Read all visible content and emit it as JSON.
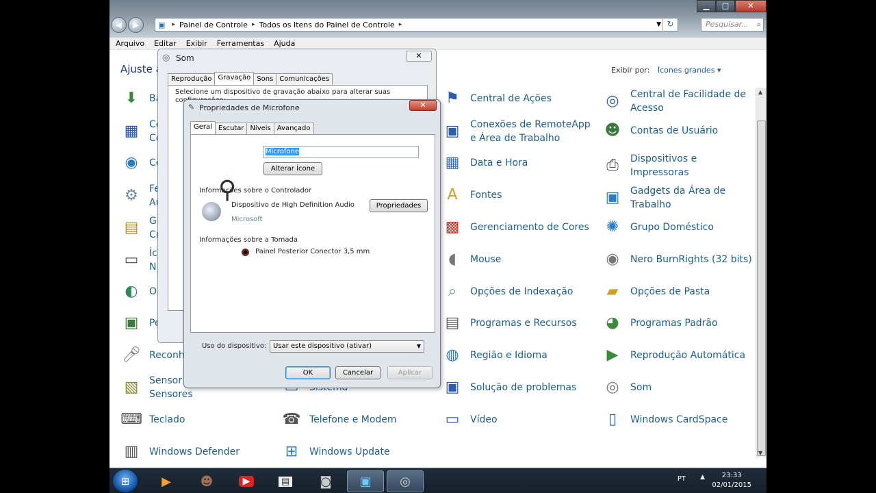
{
  "window": {
    "address": [
      "Painel de Controle",
      "Todos os Itens do Painel de Controle"
    ],
    "search_placeholder": "Pesquisar...",
    "caption": {
      "minimize": "▁",
      "maximize": "□",
      "close": "✕"
    }
  },
  "menubar": [
    "Arquivo",
    "Editar",
    "Exibir",
    "Ferramentas",
    "Ajuda"
  ],
  "header": {
    "title": "Ajuste as",
    "viewby_label": "Exibir por:",
    "viewby_value": "Ícones grandes ▾"
  },
  "items": [
    {
      "label": "Ba",
      "icon": "backup-icon"
    },
    {
      "label": "Ce Co",
      "icon": "certificate-icon"
    },
    {
      "label": "Ce",
      "icon": "center-icon"
    },
    {
      "label": "Fe Au",
      "icon": "tools-icon"
    },
    {
      "label": "Ge Cr",
      "icon": "credential-icon"
    },
    {
      "label": "Íc N",
      "icon": "notification-icon"
    },
    {
      "label": "Op",
      "icon": "options-icon"
    },
    {
      "label": "Pe",
      "icon": "personalize-icon"
    },
    {
      "label": "Reconhe",
      "icon": "microphone-icon"
    },
    {
      "label": "Sensor Outros Sensores",
      "icon": "sensor-icon"
    },
    {
      "label": "Teclado",
      "icon": "keyboard-icon"
    },
    {
      "label": "Windows Defender",
      "icon": "defender-icon"
    },
    {
      "label": "Sistema",
      "icon": "system-icon"
    },
    {
      "label": "Telefone e Modem",
      "icon": "phone-icon"
    },
    {
      "label": "Windows Update",
      "icon": "update-icon"
    },
    {
      "label": "Central de Ações",
      "icon": "flag-icon"
    },
    {
      "label": "Conexões de RemoteApp e Área de Trabalho",
      "icon": "remoteapp-icon"
    },
    {
      "label": "Data e Hora",
      "icon": "calendar-icon"
    },
    {
      "label": "Fontes",
      "icon": "font-icon"
    },
    {
      "label": "Gerenciamento de Cores",
      "icon": "color-icon"
    },
    {
      "label": "Mouse",
      "icon": "mouse-icon"
    },
    {
      "label": "Opções de Indexação",
      "icon": "index-icon"
    },
    {
      "label": "Programas e Recursos",
      "icon": "programs-icon"
    },
    {
      "label": "Região e Idioma",
      "icon": "globe-icon"
    },
    {
      "label": "Solução de problemas",
      "icon": "troubleshoot-icon"
    },
    {
      "label": "Vídeo",
      "icon": "monitor-icon"
    },
    {
      "label": "Central de Facilidade de Acesso",
      "icon": "accessibility-icon"
    },
    {
      "label": "Contas de Usuário",
      "icon": "users-icon"
    },
    {
      "label": "Dispositivos e Impressoras",
      "icon": "printer-icon"
    },
    {
      "label": "Gadgets da Área de Trabalho",
      "icon": "gadgets-icon"
    },
    {
      "label": "Grupo Doméstico",
      "icon": "homegroup-icon"
    },
    {
      "label": "Nero BurnRights (32 bits)",
      "icon": "nero-icon"
    },
    {
      "label": "Opções de Pasta",
      "icon": "folder-icon"
    },
    {
      "label": "Programas Padrão",
      "icon": "default-programs-icon"
    },
    {
      "label": "Reprodução Automática",
      "icon": "autoplay-icon"
    },
    {
      "label": "Som",
      "icon": "speaker-icon"
    },
    {
      "label": "Windows CardSpace",
      "icon": "cardspace-icon"
    }
  ],
  "som": {
    "title": "Som",
    "close": "✕",
    "tabs": [
      "Reprodução",
      "Gravação",
      "Sons",
      "Comunicações"
    ],
    "desc": "Selecione um dispositivo de gravação abaixo para alterar suas configurações:"
  },
  "mic": {
    "title": "Propriedades de Microfone",
    "close": "✕",
    "tabs": [
      "Geral",
      "Escutar",
      "Níveis",
      "Avançado"
    ],
    "name_value": "Microfone",
    "change_icon": "Alterar Ícone",
    "controller_heading": "Informações sobre o Controlador",
    "controller_name": "Dispositivo de High Definition Audio",
    "controller_vendor": "Microsoft",
    "properties_btn": "Propriedades",
    "jack_heading": "Informações sobre a Tomada",
    "jack_name": "Painel Posterior Conector 3,5 mm",
    "usage_label": "Uso do dispositivo:",
    "usage_value": "Usar este dispositivo (ativar)",
    "ok": "OK",
    "cancel": "Cancelar",
    "apply": "Aplicar"
  },
  "taskbar": {
    "lang": "PT",
    "time": "23:33",
    "date": "02/01/2015"
  }
}
